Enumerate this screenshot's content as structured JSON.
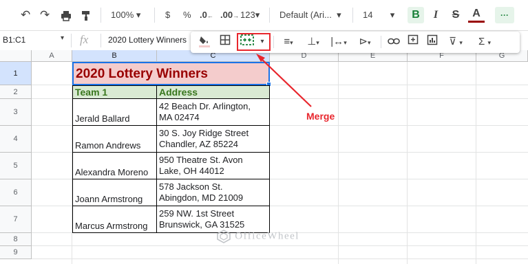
{
  "toolbar": {
    "undo_icon": "undo-icon",
    "redo_icon": "redo-icon",
    "print_icon": "print-icon",
    "paint_format_icon": "paint-format-icon",
    "zoom": "100%",
    "currency": "$",
    "percent": "%",
    "decrease_decimal": ".0",
    "increase_decimal": ".00",
    "more_formats": "123",
    "font": "Default (Ari...",
    "font_size": "14",
    "bold": "B",
    "italic": "I",
    "strikethrough": "S",
    "text_color": "A",
    "more": "···"
  },
  "formula_bar": {
    "name_box": "B1:C1",
    "fx": "fx",
    "content": "2020 Lottery Winners"
  },
  "columns": [
    "A",
    "B",
    "C",
    "D",
    "E",
    "F",
    "G"
  ],
  "rows": [
    "1",
    "2",
    "3",
    "4",
    "5",
    "6",
    "7",
    "8",
    "9"
  ],
  "sheet": {
    "title": "2020 Lottery Winners",
    "headers": [
      "Team 1",
      "Address"
    ],
    "data": [
      {
        "name": "Jerald Ballard",
        "addr1": "42 Beach Dr. Arlington,",
        "addr2": "MA 02474"
      },
      {
        "name": "Ramon Andrews",
        "addr1": "30 S. Joy Ridge Street",
        "addr2": "Chandler, AZ 85224"
      },
      {
        "name": "Alexandra Moreno",
        "addr1": "950 Theatre St. Avon",
        "addr2": "Lake, OH 44012"
      },
      {
        "name": "Joann Armstrong",
        "addr1": "578 Jackson St.",
        "addr2": "Abingdon, MD 21009"
      },
      {
        "name": "Marcus Armstrong",
        "addr1": "259 NW. 1st Street",
        "addr2": "Brunswick, GA 31525"
      }
    ]
  },
  "annotation": {
    "label": "Merge",
    "color": "#e8262d"
  },
  "watermark": "OfficeWheel",
  "colors": {
    "title_fill": "#f4cccc",
    "title_text": "#990000",
    "header_fill": "#d9ead3",
    "header_text": "#38761d",
    "selection": "#1a73e8"
  }
}
